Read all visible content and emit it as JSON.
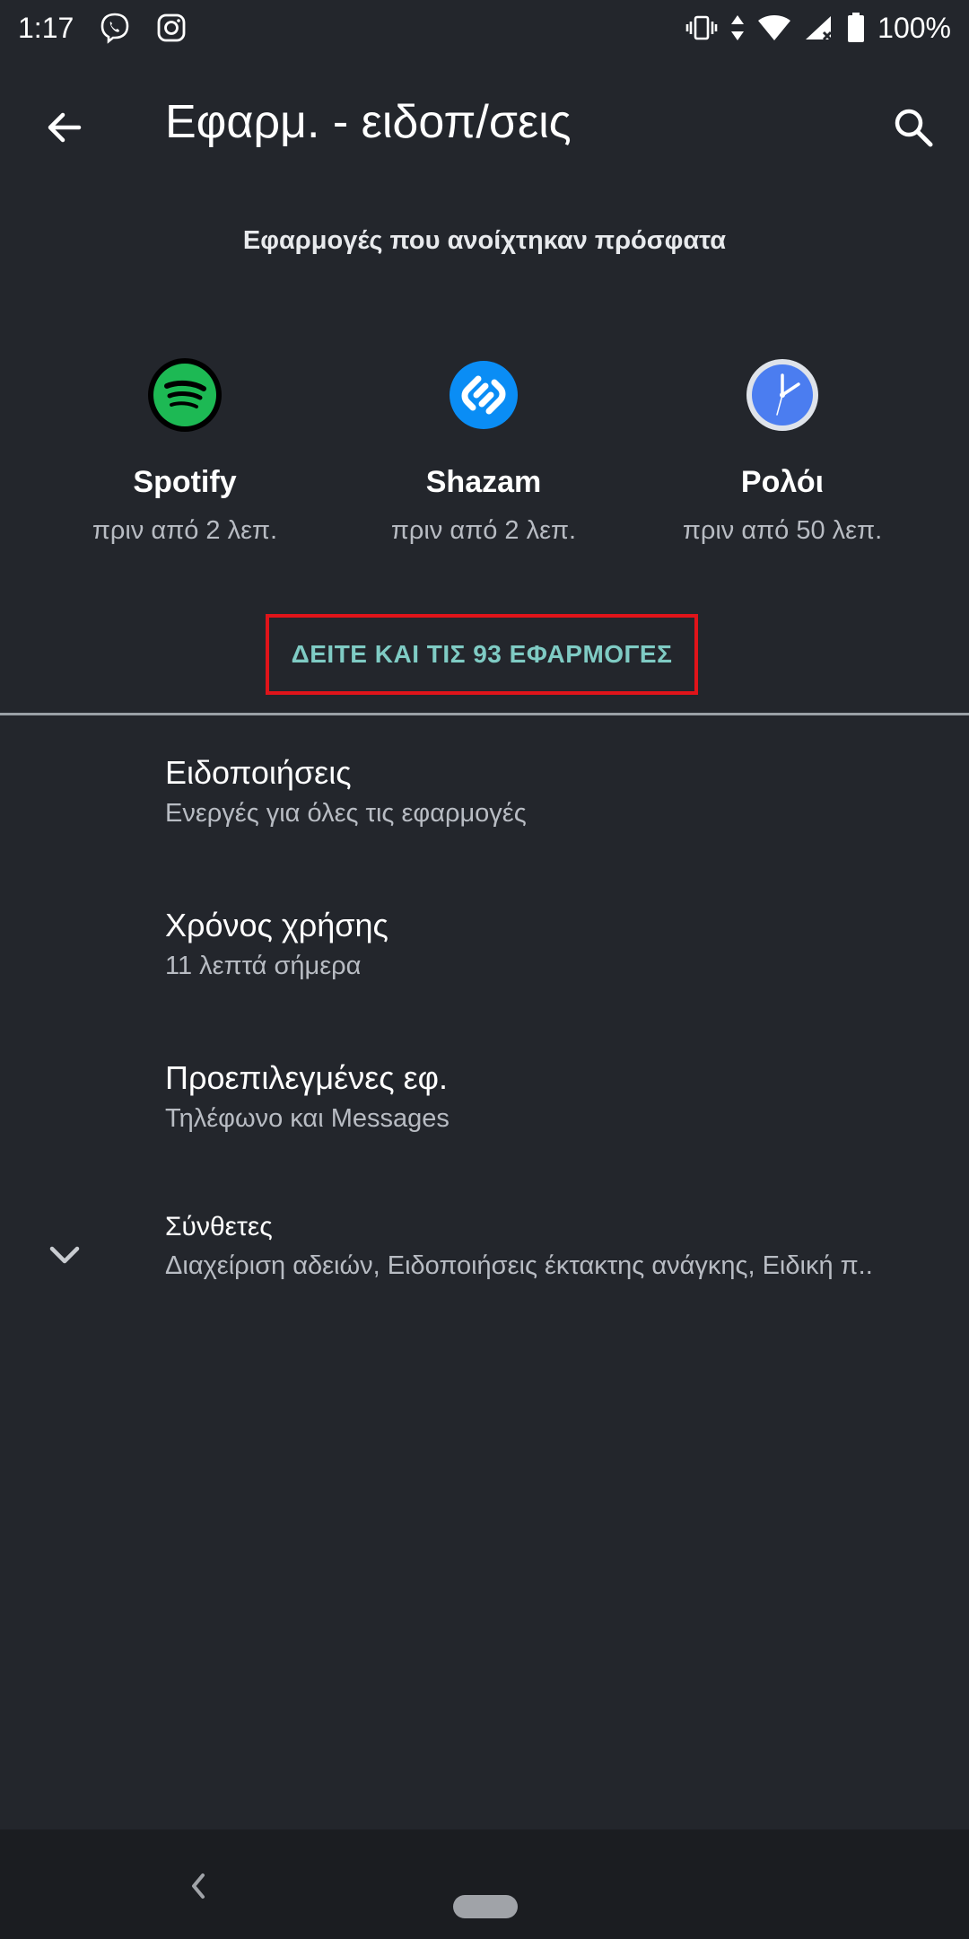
{
  "status_bar": {
    "time": "1:17",
    "battery": "100%",
    "icons": [
      "viber-icon",
      "instagram-icon",
      "vibrate-icon",
      "data-arrows-icon",
      "wifi-icon",
      "signal-icon",
      "battery-icon"
    ]
  },
  "app_bar": {
    "title": "Εφαρμ. - ειδοπ/σεις",
    "back_icon": "arrow-back-icon",
    "search_icon": "search-icon"
  },
  "recent": {
    "header": "Εφαρμογές που ανοίχτηκαν πρόσφατα",
    "apps": [
      {
        "name": "Spotify",
        "time": "πριν από 2 λεπ.",
        "icon": "spotify-icon",
        "color": "#1db954"
      },
      {
        "name": "Shazam",
        "time": "πριν από 2 λεπ.",
        "icon": "shazam-icon",
        "color": "#0a8df5"
      },
      {
        "name": "Ρολόι",
        "time": "πριν από 50 λεπ.",
        "icon": "clock-icon",
        "color": "#4b7df0"
      }
    ],
    "see_all": "ΔΕΙΤΕ ΚΑΙ ΤΙΣ 93 ΕΦΑΡΜΟΓΕΣ"
  },
  "settings": {
    "items": [
      {
        "title": "Ειδοποιήσεις",
        "subtitle": "Ενεργές για όλες τις εφαρμογές"
      },
      {
        "title": "Χρόνος χρήσης",
        "subtitle": "11 λεπτά σήμερα"
      },
      {
        "title": "Προεπιλεγμένες εφ.",
        "subtitle": "Τηλέφωνο και Messages"
      },
      {
        "title": "Σύνθετες",
        "subtitle": "Διαχείριση αδειών, Ειδοποιήσεις έκτακτης ανάγκης, Ειδική π.."
      }
    ]
  },
  "colors": {
    "background": "#23262c",
    "accent": "#7fcbc4",
    "highlight_border": "#e0141a",
    "nav_bar": "#1b1d21"
  }
}
